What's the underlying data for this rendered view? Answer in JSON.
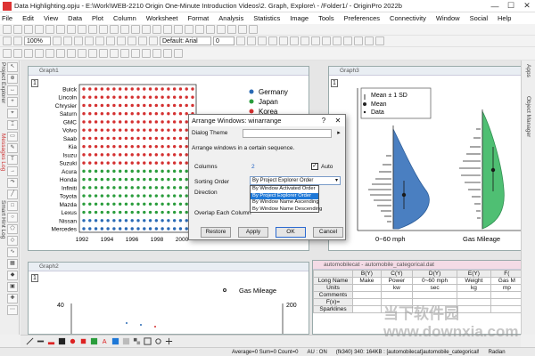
{
  "window": {
    "title": "Data Highlighting.opju - E:\\Work\\WEB-2210 Origin One-Minute Introduction Videos\\2. Graph, Explore\\ - /Folder1/ - OriginPro 2022b",
    "minimize": "—",
    "maximize": "☐",
    "close": "✕"
  },
  "menu": [
    "File",
    "Edit",
    "View",
    "Data",
    "Plot",
    "Column",
    "Worksheet",
    "Format",
    "Analysis",
    "Statistics",
    "Image",
    "Tools",
    "Preferences",
    "Connectivity",
    "Window",
    "Social",
    "Help"
  ],
  "toolbar": {
    "zoom": "100%",
    "font": "Default: Arial",
    "font_size": "0"
  },
  "side_labels": [
    "Project Explorer",
    "Messages Log",
    "Smart Hint Log"
  ],
  "right_labels": [
    "Apps",
    "Object Manager"
  ],
  "graph1": {
    "title": "Graph1",
    "layer": "1",
    "categories": [
      "Buick",
      "Lincoln",
      "Chrysler",
      "Saturn",
      "GMC",
      "Volvo",
      "Saab",
      "Kia",
      "Isuzu",
      "Suzuki",
      "Acura",
      "Honda",
      "Infiniti",
      "Toyota",
      "Mazda",
      "Lexus",
      "Nissan",
      "Mercedes"
    ],
    "x_ticks": [
      "1992",
      "1994",
      "1996",
      "1998",
      "2000"
    ],
    "legend": [
      {
        "name": "Germany",
        "color": "#2a6ab5"
      },
      {
        "name": "Japan",
        "color": "#2a9d3c"
      },
      {
        "name": "Korea",
        "color": "#d43030"
      }
    ]
  },
  "graph3": {
    "title": "Graph3",
    "layer": "1",
    "legend": [
      "Mean ± 1 SD",
      "Mean",
      "Data"
    ],
    "x_labels": [
      "0~60 mph",
      "Gas Mileage"
    ],
    "colors": {
      "left": "#4a7fc1",
      "right": "#4fbf73"
    }
  },
  "graph2": {
    "title": "Graph2",
    "layer": "1",
    "y_ticks_left": [
      "40"
    ],
    "y_ticks_right": [
      "200"
    ],
    "legend": "Gas Mileage"
  },
  "dialog": {
    "title": "Arrange Windows: winarrange",
    "theme_label": "Dialog Theme",
    "description": "Arrange windows in a certain sequence.",
    "columns_label": "Columns",
    "columns_value": "2",
    "auto_label": "Auto",
    "sorting_label": "Sorting Order",
    "direction_label": "Direction",
    "overlap_label": "Overlap Each Column",
    "sorting_value": "By Project Explorer Order",
    "options": [
      "By Window Activated Order",
      "By Project Explorer Order",
      "By Window Name Ascending",
      "By Window Name Descending"
    ],
    "buttons": {
      "restore": "Restore",
      "apply": "Apply",
      "ok": "OK",
      "cancel": "Cancel"
    }
  },
  "workbook": {
    "title": "automobilecat - automobile_categorical.dat",
    "headers": [
      "",
      "B(Y)",
      "C(Y)",
      "D(Y)",
      "E(Y)",
      "F("
    ],
    "rows": [
      [
        "Long Name",
        "Make",
        "Power",
        "0~60 mph",
        "Weight",
        "Gas M"
      ],
      [
        "Units",
        "",
        "kw",
        "sec",
        "kg",
        "mp"
      ],
      [
        "Comments",
        "",
        "",
        "",
        "",
        ""
      ],
      [
        "F(x)=",
        "",
        "",
        "",
        "",
        ""
      ],
      [
        "Sparklines",
        "",
        "",
        "",
        "",
        ""
      ]
    ]
  },
  "status": {
    "summary": "Average=0 Sum=0 Count=0",
    "mode": "AU : ON",
    "info": "(fk340) 340: 164KB : [automobilecat]automobile_categorical!",
    "units": "Radian"
  },
  "watermark": "当下软件园 www.downxia.com"
}
